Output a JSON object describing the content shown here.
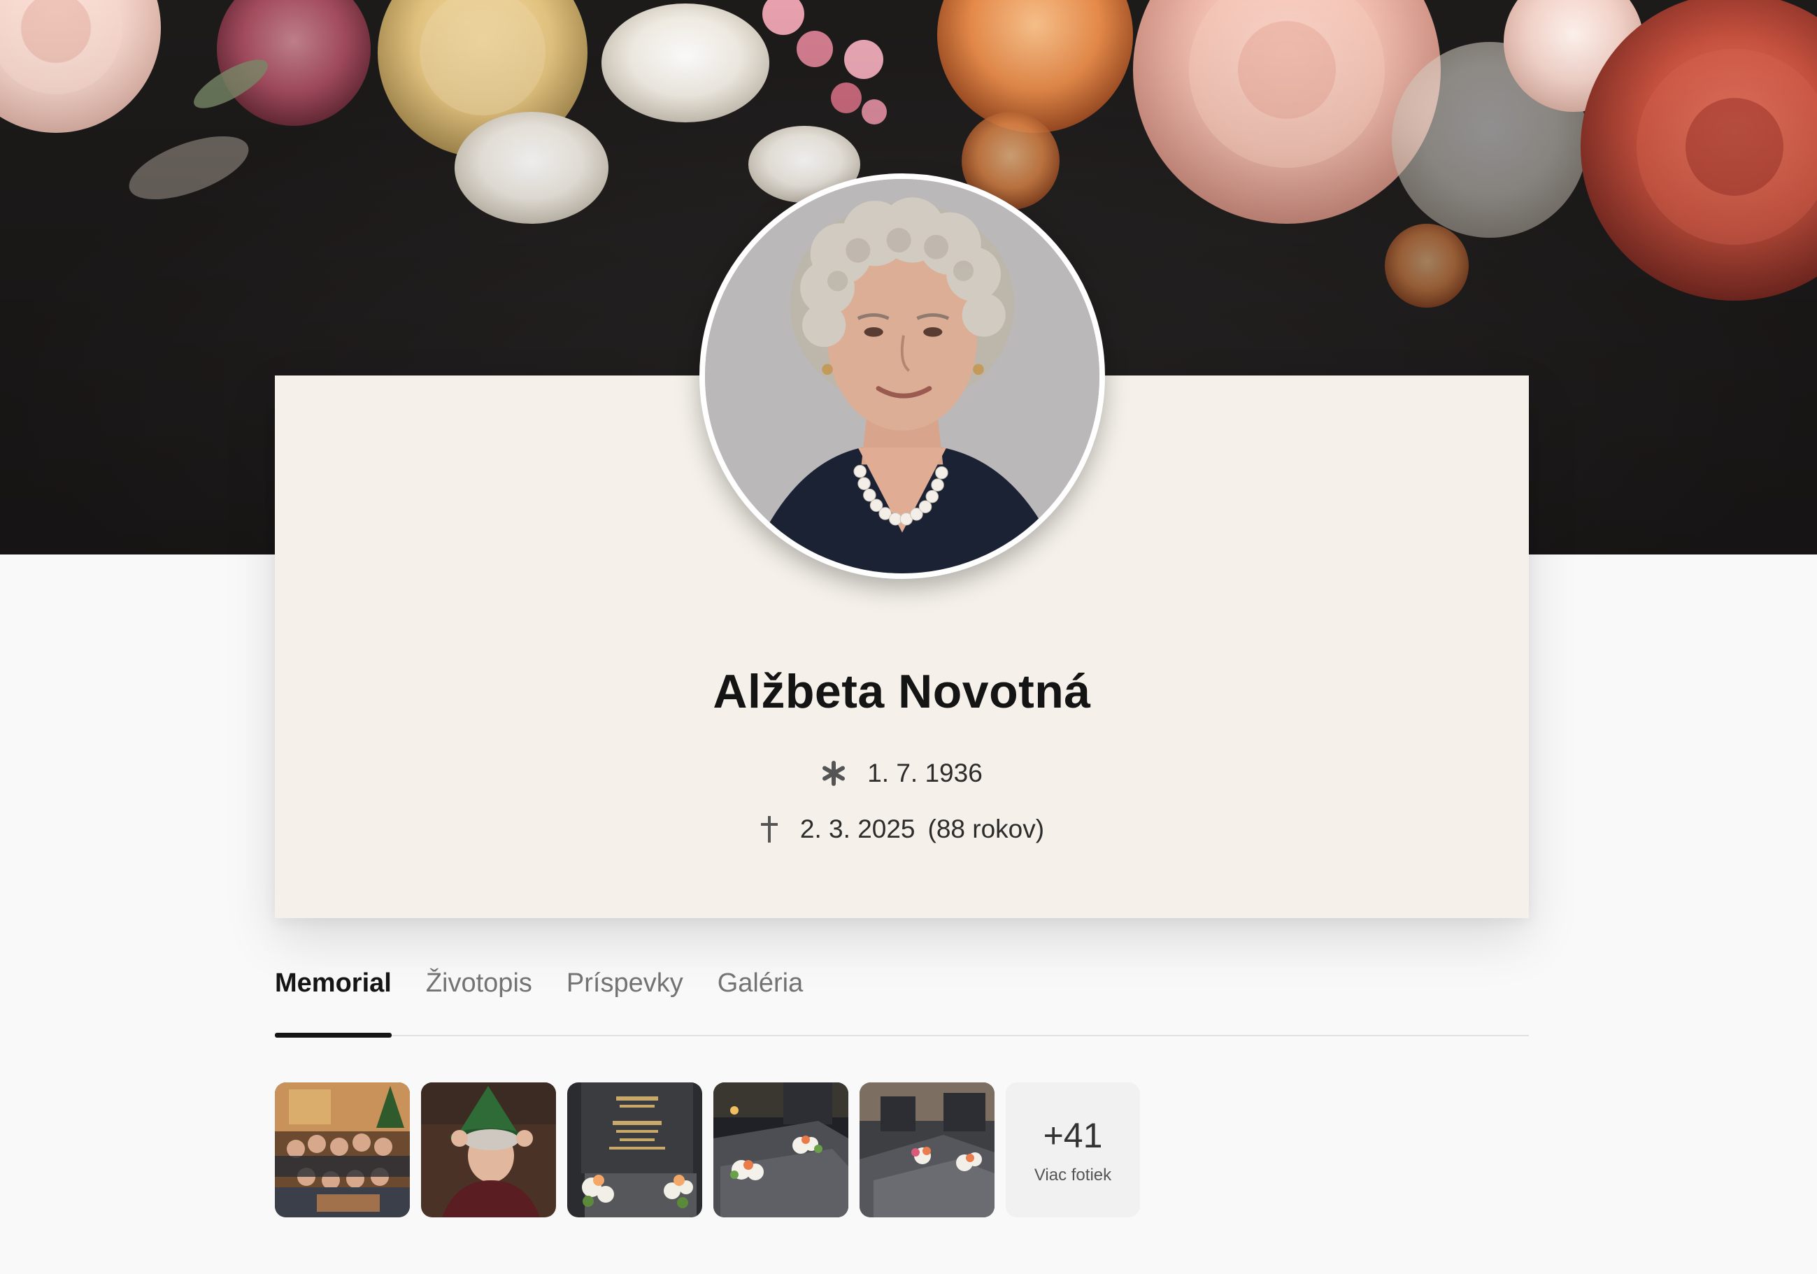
{
  "profile": {
    "name": "Alžbeta Novotná",
    "birth_symbol": "✱",
    "birth_date": "1. 7. 1936",
    "death_symbol": "✝",
    "death_date": "2. 3. 2025",
    "age": "(88 rokov)"
  },
  "tabs": [
    {
      "label": "Memorial",
      "active": true
    },
    {
      "label": "Životopis",
      "active": false
    },
    {
      "label": "Príspevky",
      "active": false
    },
    {
      "label": "Galéria",
      "active": false
    }
  ],
  "gallery": {
    "more_count": "+41",
    "more_label": "Viac fotiek"
  },
  "colors": {
    "card_bg": "#f5f1ea",
    "page_bg": "#f9f9f9",
    "hero_bg": "#231f1f",
    "active_tab": "#151515",
    "inactive_tab": "#737373"
  },
  "icons": {
    "birth": "asterisk-icon",
    "death": "cross-icon"
  }
}
